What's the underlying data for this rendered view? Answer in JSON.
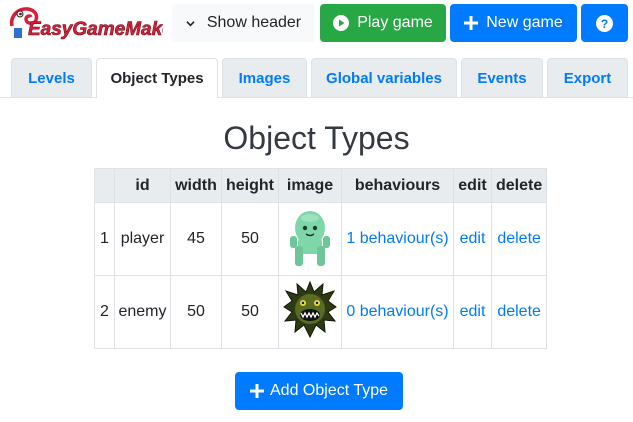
{
  "app": {
    "logo_text": "EasyGameMaker"
  },
  "toolbar": {
    "show_header_label": "Show header",
    "play_label": "Play game",
    "new_game_label": "New game",
    "help_label": "?"
  },
  "tabs": [
    {
      "label": "Levels"
    },
    {
      "label": "Object Types"
    },
    {
      "label": "Images"
    },
    {
      "label": "Global variables"
    },
    {
      "label": "Events"
    },
    {
      "label": "Export"
    }
  ],
  "active_tab": "Object Types",
  "page": {
    "title": "Object Types"
  },
  "table": {
    "columns": [
      "",
      "id",
      "width",
      "height",
      "image",
      "behaviours",
      "edit",
      "delete"
    ],
    "rows": [
      {
        "num": "1",
        "id": "player",
        "width": "45",
        "height": "50",
        "image": "green-alien-sprite",
        "behaviours": "1 behaviour(s)",
        "edit": "edit",
        "delete": "delete"
      },
      {
        "num": "2",
        "id": "enemy",
        "width": "50",
        "height": "50",
        "image": "spiky-monster-sprite",
        "behaviours": "0 behaviour(s)",
        "edit": "edit",
        "delete": "delete"
      }
    ]
  },
  "add_button_label": "Add Object Type",
  "colors": {
    "primary": "#007bff",
    "success": "#28a745",
    "tab_bg": "#e9ecef"
  }
}
